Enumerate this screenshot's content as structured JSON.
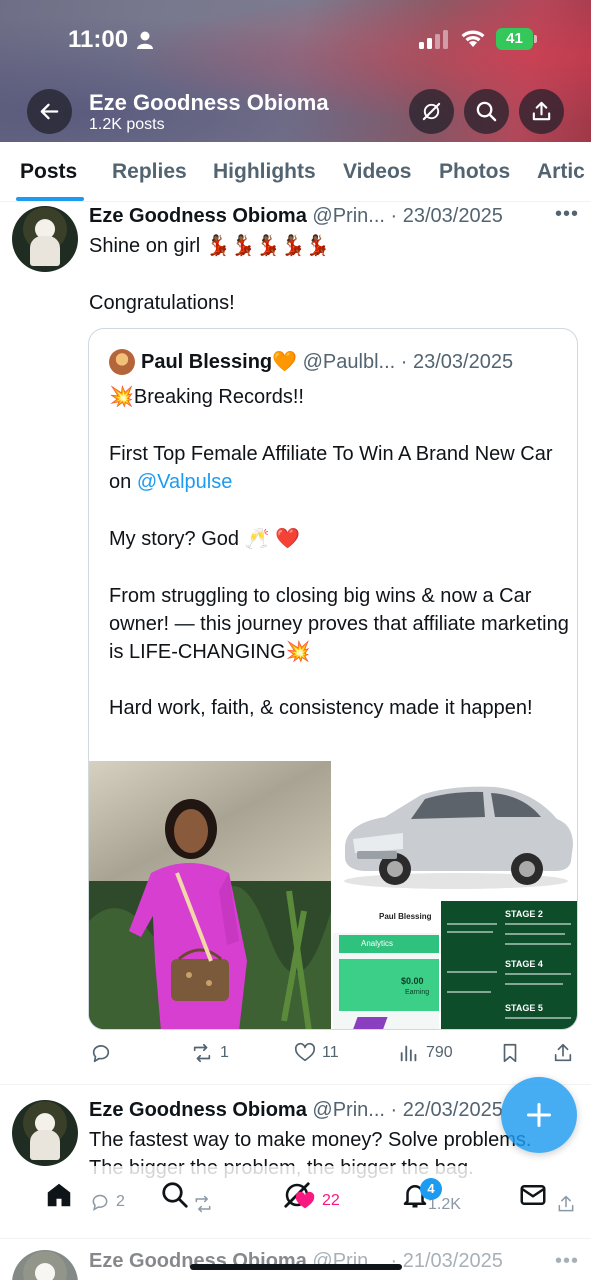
{
  "status_bar": {
    "time": "11:00",
    "battery": "41"
  },
  "header": {
    "name": "Eze Goodness Obioma",
    "posts_count": "1.2K posts"
  },
  "tabs": [
    "Posts",
    "Replies",
    "Highlights",
    "Videos",
    "Photos",
    "Artic"
  ],
  "tweet1": {
    "name": "Eze Goodness Obioma",
    "handle": "@Prin...",
    "date": "· 23/03/2025",
    "text_line1": "Shine on girl 💃🏾💃🏾💃🏾💃🏾💃🏾",
    "text_line2": "Congratulations!",
    "quote": {
      "name": "Paul Blessing",
      "badge": "🧡",
      "handle": "@Paulbl...",
      "date": "· 23/03/2025",
      "p1": "💥Breaking Records!!",
      "p2_prefix": "First Top Female Affiliate To Win A Brand New Car on ",
      "p2_link": "@Valpulse",
      "p3": "My story?  God 🥂  ❤️",
      "p4": "From struggling to closing big wins & now a Car owner! — this journey proves that affiliate marketing is LIFE-CHANGING💥",
      "p5": " Hard work, faith, & consistency made it happen!"
    },
    "media": {
      "dashboard_user": "Paul Blessing",
      "dashboard_tab": "Analytics",
      "earning_amount": "$0.00",
      "earning_label": "Earning",
      "stage_labels": [
        "STAGE 2",
        "STAGE 4",
        "STAGE 5"
      ]
    },
    "stats": {
      "replies": "",
      "reposts": "1",
      "likes": "11",
      "views": "790"
    }
  },
  "tweet2": {
    "name": "Eze Goodness Obioma",
    "handle": "@Prin...",
    "date": "· 22/03/2025",
    "text_line1": "The fastest way to make money? Solve problems.",
    "text_line2": "The bigger the problem, the bigger the bag.",
    "stats": {
      "replies": "2",
      "likes": "22",
      "views": "1.2K"
    }
  },
  "tweet3": {
    "name": "Eze Goodness Obioma",
    "handle": "@Prin...",
    "date": "· 21/03/2025"
  },
  "bottom_nav": {
    "notification_count": "4"
  },
  "colors": {
    "accent": "#1d9bf0",
    "text": "#0f1419",
    "muted": "#536471",
    "like_pink": "#f91880"
  }
}
